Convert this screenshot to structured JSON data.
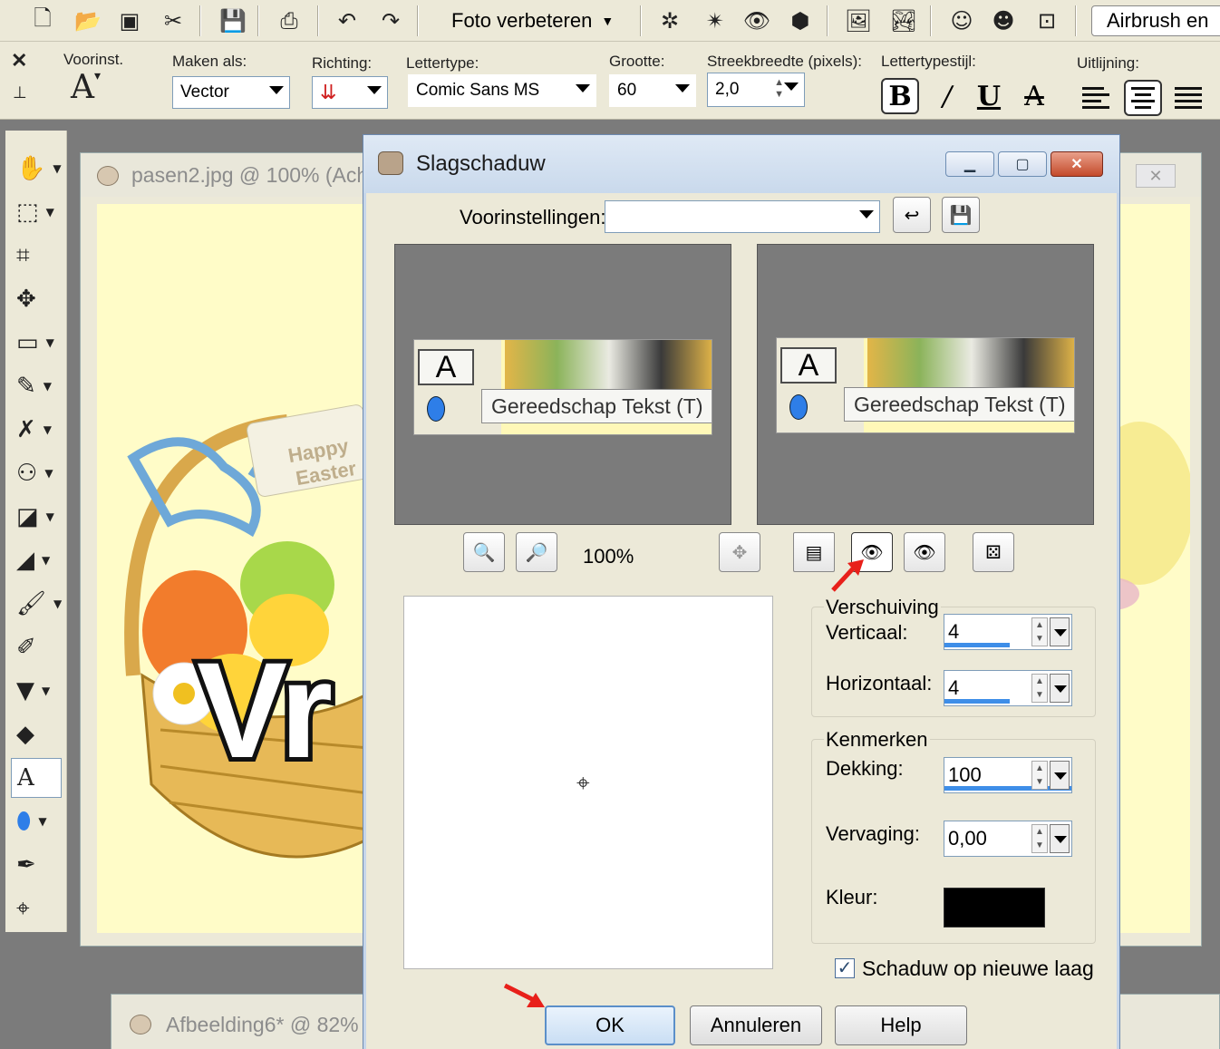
{
  "toolbar": {
    "enhance_label": "Foto verbeteren",
    "airbrush_label": "Airbrush en"
  },
  "tool_options": {
    "presets_label": "Voorinst.",
    "create_as_label": "Maken als:",
    "create_as_value": "Vector",
    "direction_label": "Richting:",
    "font_label": "Lettertype:",
    "font_value": "Comic Sans MS",
    "size_label": "Grootte:",
    "size_value": "60",
    "stroke_label": "Streekbreedte (pixels):",
    "stroke_value": "2,0",
    "style_label": "Lettertypestijl:",
    "align_label": "Uitlijning:"
  },
  "documents": {
    "doc1_title": "pasen2.jpg @ 100% (Ach",
    "doc2_title": "Afbeelding6* @ 82%",
    "canvas_text_happy": "Happy",
    "canvas_text_easter": "Easter"
  },
  "dialog": {
    "title": "Slagschaduw",
    "presets_label": "Voorinstellingen:",
    "presets_value": "",
    "preview_tooltip": "Gereedschap Tekst (T)",
    "zoom_value": "100%",
    "offset": {
      "legend": "Verschuiving",
      "vertical_label": "Verticaal:",
      "vertical_value": "4",
      "horizontal_label": "Horizontaal:",
      "horizontal_value": "4"
    },
    "attributes": {
      "legend": "Kenmerken",
      "opacity_label": "Dekking:",
      "opacity_value": "100",
      "blur_label": "Vervaging:",
      "blur_value": "0,00",
      "color_label": "Kleur:",
      "color_value": "#000000"
    },
    "new_layer_label": "Schaduw op nieuwe laag",
    "new_layer_checked": true,
    "buttons": {
      "ok": "OK",
      "cancel": "Annuleren",
      "help": "Help"
    }
  },
  "colors": {
    "accent_red_arrow": "#e8201a",
    "canvas_yellow": "#fffcc8",
    "tool_blue": "#2e7ee8"
  }
}
